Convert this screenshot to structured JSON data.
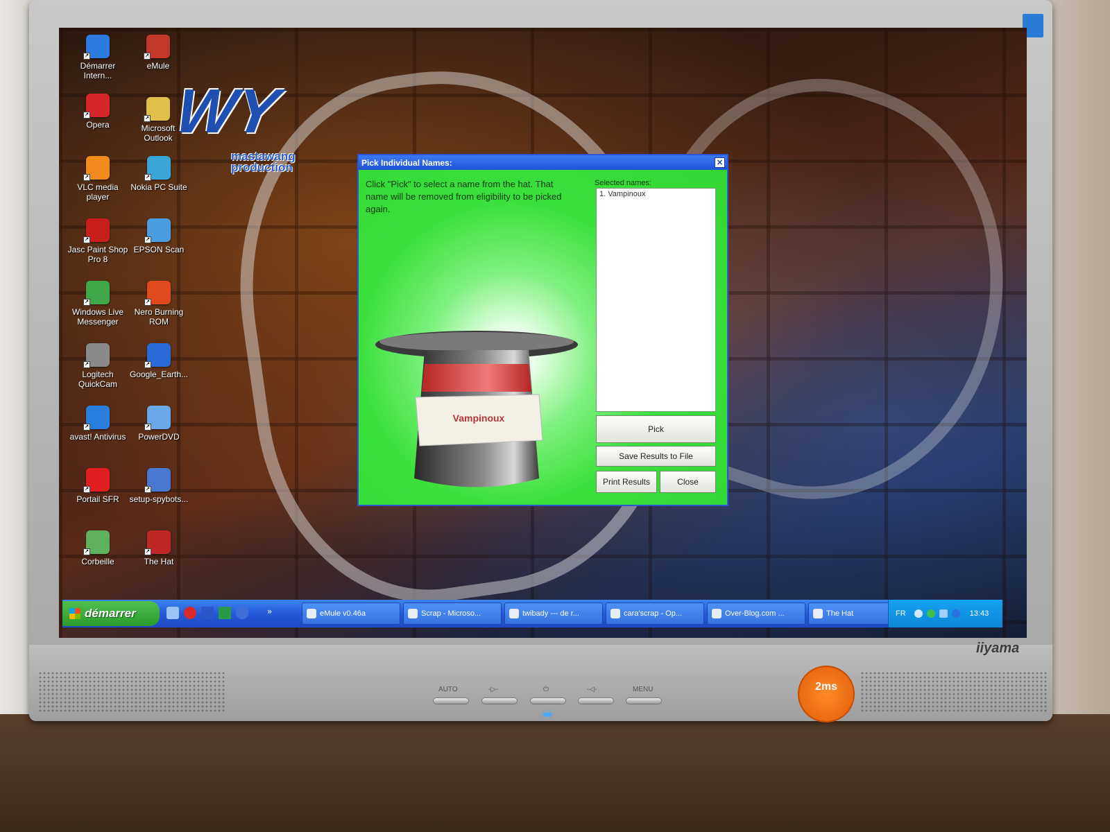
{
  "desktop": {
    "icons": [
      {
        "label": "Démarrer\nIntern...",
        "icon": "internet-explorer-icon",
        "color": "#2d7be0"
      },
      {
        "label": "eMule",
        "icon": "emule-icon",
        "color": "#c4382b"
      },
      {
        "label": "Opera",
        "icon": "opera-icon",
        "color": "#d6252b"
      },
      {
        "label": "Microsoft\nOutlook",
        "icon": "outlook-icon",
        "color": "#e0c04a"
      },
      {
        "label": "VLC media\nplayer",
        "icon": "vlc-icon",
        "color": "#f28a1e"
      },
      {
        "label": "Nokia PC Suite",
        "icon": "nokia-icon",
        "color": "#3aa6d8"
      },
      {
        "label": "Jasc Paint Shop\nPro 8",
        "icon": "paintshop-icon",
        "color": "#c81e1e"
      },
      {
        "label": "EPSON Scan",
        "icon": "scanner-icon",
        "color": "#4a9ee0"
      },
      {
        "label": "Windows Live\nMessenger",
        "icon": "messenger-icon",
        "color": "#3fa84a"
      },
      {
        "label": "Nero Burning\nROM",
        "icon": "nero-icon",
        "color": "#e04a1e"
      },
      {
        "label": "Logitech\nQuickCam",
        "icon": "webcam-icon",
        "color": "#8a8a8a"
      },
      {
        "label": "Google_Earth...",
        "icon": "globe-icon",
        "color": "#2a6ad6"
      },
      {
        "label": "avast! Antivirus",
        "icon": "avast-icon",
        "color": "#2a7ee0"
      },
      {
        "label": "PowerDVD",
        "icon": "dvd-icon",
        "color": "#6aa8e8"
      },
      {
        "label": "Portail SFR",
        "icon": "sfr-icon",
        "color": "#e02020"
      },
      {
        "label": "setup-spybots...",
        "icon": "setup-icon",
        "color": "#4a7ad0"
      },
      {
        "label": "Corbeille",
        "icon": "recycle-bin-icon",
        "color": "#5fb05f"
      },
      {
        "label": "The Hat",
        "icon": "hat-icon",
        "color": "#c02828"
      }
    ],
    "logo_text": "mastawang\nproduction"
  },
  "dialog": {
    "title": "Pick Individual Names:",
    "instructions": "Click \"Pick\" to select a name from the hat. That name will be removed from eligibility to be picked again.",
    "selected_label": "Selected names:",
    "selected": [
      "1. Vampinoux"
    ],
    "hat_name": "Vampinoux",
    "buttons": {
      "pick": "Pick",
      "save": "Save Results to File",
      "print": "Print Results",
      "close": "Close"
    }
  },
  "taskbar": {
    "start_label": "démarrer",
    "tasks": [
      {
        "label": "eMule v0.46a",
        "icon": "emule-icon"
      },
      {
        "label": "Scrap - Microso...",
        "icon": "publisher-icon"
      },
      {
        "label": "twibady --- de r...",
        "icon": "messenger-icon"
      },
      {
        "label": "cara'scrap - Op...",
        "icon": "opera-icon"
      },
      {
        "label": "Over-Blog.com ...",
        "icon": "internet-explorer-icon"
      },
      {
        "label": "The Hat",
        "icon": "hat-icon"
      }
    ],
    "language": "FR",
    "clock": "13:43",
    "overflow": "»"
  },
  "monitor": {
    "brand": "iiyama",
    "osd": [
      "AUTO",
      "-▷-",
      "⏻",
      "-◁-",
      "MENU"
    ],
    "sticker": "2ms"
  }
}
